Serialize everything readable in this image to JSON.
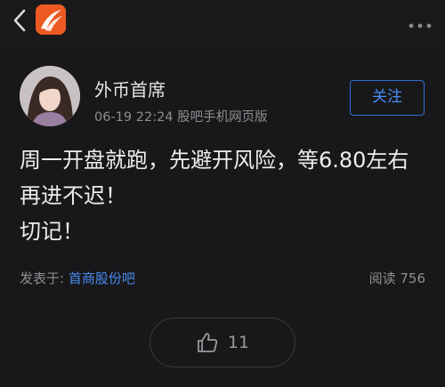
{
  "header": {
    "back_icon": "chevron-left-icon",
    "app_logo": "eastmoney-logo",
    "more_icon": "more-dots-icon",
    "logo_color": "#ec5a22"
  },
  "post": {
    "author": "外币首席",
    "meta": "06-19 22:24 股吧手机网页版",
    "follow_label": "关注",
    "content_lines": [
      "周一开盘就跑，先避开风险，等6.80左右",
      "再进不迟！",
      "切记！"
    ],
    "published_label": "发表于:",
    "forum_name": "首商股份吧",
    "views_label": "阅读",
    "views_count": "756",
    "like_icon": "thumbs-up-icon",
    "like_count": "11"
  },
  "colors": {
    "background": "#18181a",
    "accent": "#4a8bf2",
    "muted_text": "#8e8e92"
  }
}
